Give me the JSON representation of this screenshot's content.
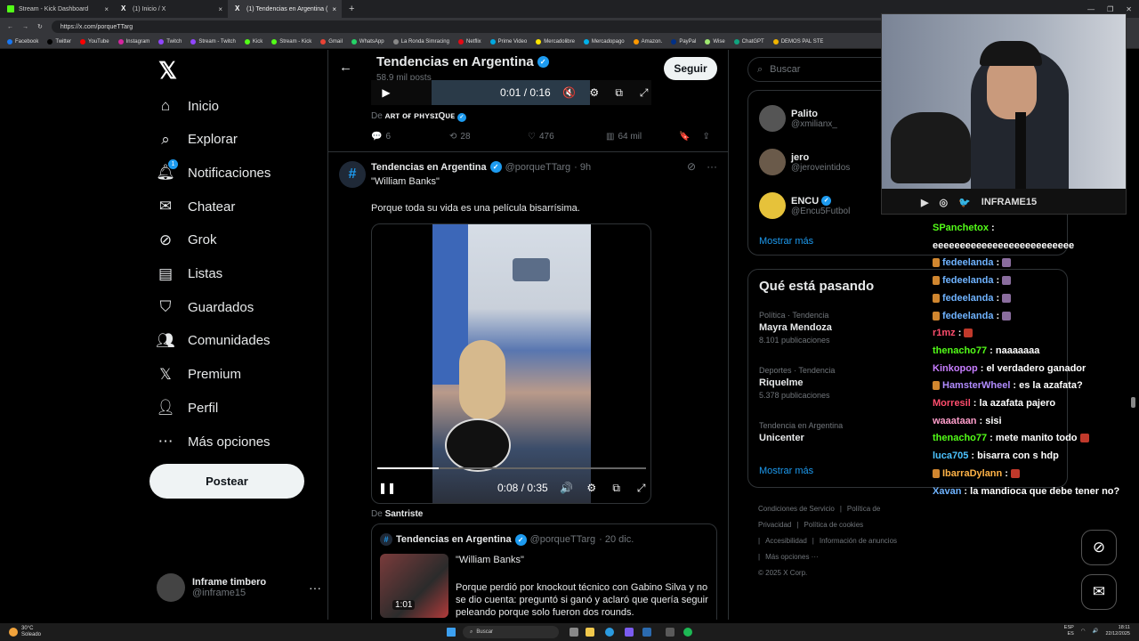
{
  "browser": {
    "tabs": [
      {
        "label": "Stream - Kick Dashboard",
        "active": false
      },
      {
        "label": "(1) Inicio / X",
        "active": false
      },
      {
        "label": "(1) Tendencias en Argentina (",
        "active": true
      }
    ],
    "new_tab": "+",
    "url": "https://x.com/porqueTTarg",
    "bookmarks": [
      "Facebook",
      "Twitter",
      "YouTube",
      "Instagram",
      "Twitch",
      "Stream - Twitch",
      "Kick",
      "Stream - Kick",
      "Gmail",
      "WhatsApp",
      "La Ronda Simracing",
      "Netflix",
      "Prime Video",
      "Mercadolibre",
      "Mercadopago",
      "Amazon.",
      "PayPal",
      "Wise",
      "ChatGPT",
      "DEMOS PAL STE"
    ]
  },
  "nav": {
    "items": [
      {
        "label": "Inicio",
        "icon": "home-icon"
      },
      {
        "label": "Explorar",
        "icon": "search-icon"
      },
      {
        "label": "Notificaciones",
        "icon": "bell-icon"
      },
      {
        "label": "Chatear",
        "icon": "mail-icon"
      },
      {
        "label": "Grok",
        "icon": "grok-icon"
      },
      {
        "label": "Listas",
        "icon": "list-icon"
      },
      {
        "label": "Guardados",
        "icon": "bookmark-icon"
      },
      {
        "label": "Comunidades",
        "icon": "communities-icon"
      },
      {
        "label": "Premium",
        "icon": "x-premium-icon"
      },
      {
        "label": "Perfil",
        "icon": "person-icon"
      },
      {
        "label": "Más opciones",
        "icon": "more-icon"
      }
    ],
    "notif_count": "1",
    "post_label": "Postear",
    "profile": {
      "name": "Inframe timbero",
      "handle": "@inframe15"
    }
  },
  "header": {
    "title": "Tendencias en Argentina",
    "posts": "58,9 mil posts",
    "follow_label": "Seguir"
  },
  "top_post": {
    "video_time": "0:01 / 0:16",
    "source_prefix": "De",
    "source": "ᴀʀᴛ ᴏғ ᴘʜʏsɪQᴜᴇ",
    "replies": "6",
    "reposts": "28",
    "likes": "476",
    "views": "64 mil"
  },
  "post": {
    "avatar": "#",
    "name": "Tendencias en Argentina",
    "handle": "@porqueTTarg",
    "time": "· 9h",
    "quote_title": "\"William Banks\"",
    "body": "Porque toda su vida es una película bisarrísima.",
    "video_time": "0:08 / 0:35",
    "progress": 0.23,
    "source_prefix": "De",
    "source": "Santriste"
  },
  "quoted": {
    "avatar": "#",
    "name": "Tendencias en Argentina",
    "handle": "@porqueTTarg",
    "time": "· 20 dic.",
    "quote_title": "\"William Banks\"",
    "body": "Porque perdió por knockout técnico con Gabino Silva y no se dio cuenta: preguntó si ganó y aclaró que quería seguir peleando porque solo fueron dos rounds.",
    "thumb_duration": "1:01"
  },
  "sidebar": {
    "search_placeholder": "Buscar",
    "who": [
      {
        "name": "Palito",
        "handle": "@xmilianx_",
        "verified": false
      },
      {
        "name": "jero",
        "handle": "@jeroveintidos",
        "verified": false
      },
      {
        "name": "ENCU",
        "handle": "@Encu5Futbol",
        "verified": true
      }
    ],
    "more_label": "Mostrar más",
    "trends_title": "Qué está pasando",
    "trends": [
      {
        "context": "Política · Tendencia",
        "topic": "Mayra Mendoza",
        "posts": "8.101 publicaciones"
      },
      {
        "context": "Deportes · Tendencia",
        "topic": "Riquelme",
        "posts": "5.378 publicaciones"
      },
      {
        "context": "Tendencia en Argentina",
        "topic": "Unicenter",
        "posts": ""
      }
    ],
    "trends_more": "Mostrar más",
    "footer": [
      "Condiciones de Servicio",
      "|",
      "Política de Privacidad",
      "|",
      "Política de cookies",
      "|",
      "Accesibilidad",
      "|",
      "Información de anuncios",
      "|",
      "Más opciones ···",
      "© 2025 X Corp."
    ]
  },
  "webcam": {
    "strip_text": "INFRAME15"
  },
  "chat": [
    {
      "user": "SPanchetox",
      "color": "#53fc18",
      "msg": ":"
    },
    {
      "user": "",
      "color": "#ffffff",
      "msg": "eeeeeeeeeeeeeeeeeeeeeeeeee"
    },
    {
      "user": "fedeelanda",
      "color": "#6fb3ff",
      "msg": ":",
      "emote": true
    },
    {
      "user": "fedeelanda",
      "color": "#6fb3ff",
      "msg": ":",
      "emote": true
    },
    {
      "user": "fedeelanda",
      "color": "#6fb3ff",
      "msg": ":",
      "emote": true
    },
    {
      "user": "fedeelanda",
      "color": "#6fb3ff",
      "msg": ":",
      "emote": true
    },
    {
      "user": "r1mz",
      "color": "#ff4d6d",
      "msg": ":",
      "emote": true
    },
    {
      "user": "thenacho77",
      "color": "#53fc18",
      "msg": ": naaaaaaa"
    },
    {
      "user": "Kinkopop",
      "color": "#c77dff",
      "msg": ": el verdadero ganador"
    },
    {
      "user": "HamsterWheel",
      "color": "#b18cff",
      "msg": ": es la azafata?"
    },
    {
      "user": "Morresil",
      "color": "#ff4d6d",
      "msg": ": la azafata pajero"
    },
    {
      "user": "waaataan",
      "color": "#ff9ecb",
      "msg": ": sisi"
    },
    {
      "user": "thenacho77",
      "color": "#53fc18",
      "msg": ": mete manito todo",
      "emote": true
    },
    {
      "user": "luca705",
      "color": "#4cc3ff",
      "msg": ": bisarra con s hdp"
    },
    {
      "user": "IbarraDylann",
      "color": "#ffb347",
      "msg": ":",
      "emote": true
    },
    {
      "user": "Xavan",
      "color": "#6fb3ff",
      "msg": ": la mandioca que debe tener no?"
    }
  ],
  "taskbar": {
    "temp": "30°C",
    "weather": "Soleado",
    "search": "Buscar",
    "lang": "ESP",
    "region": "ES",
    "time": "18:11",
    "date": "22/12/2025"
  }
}
